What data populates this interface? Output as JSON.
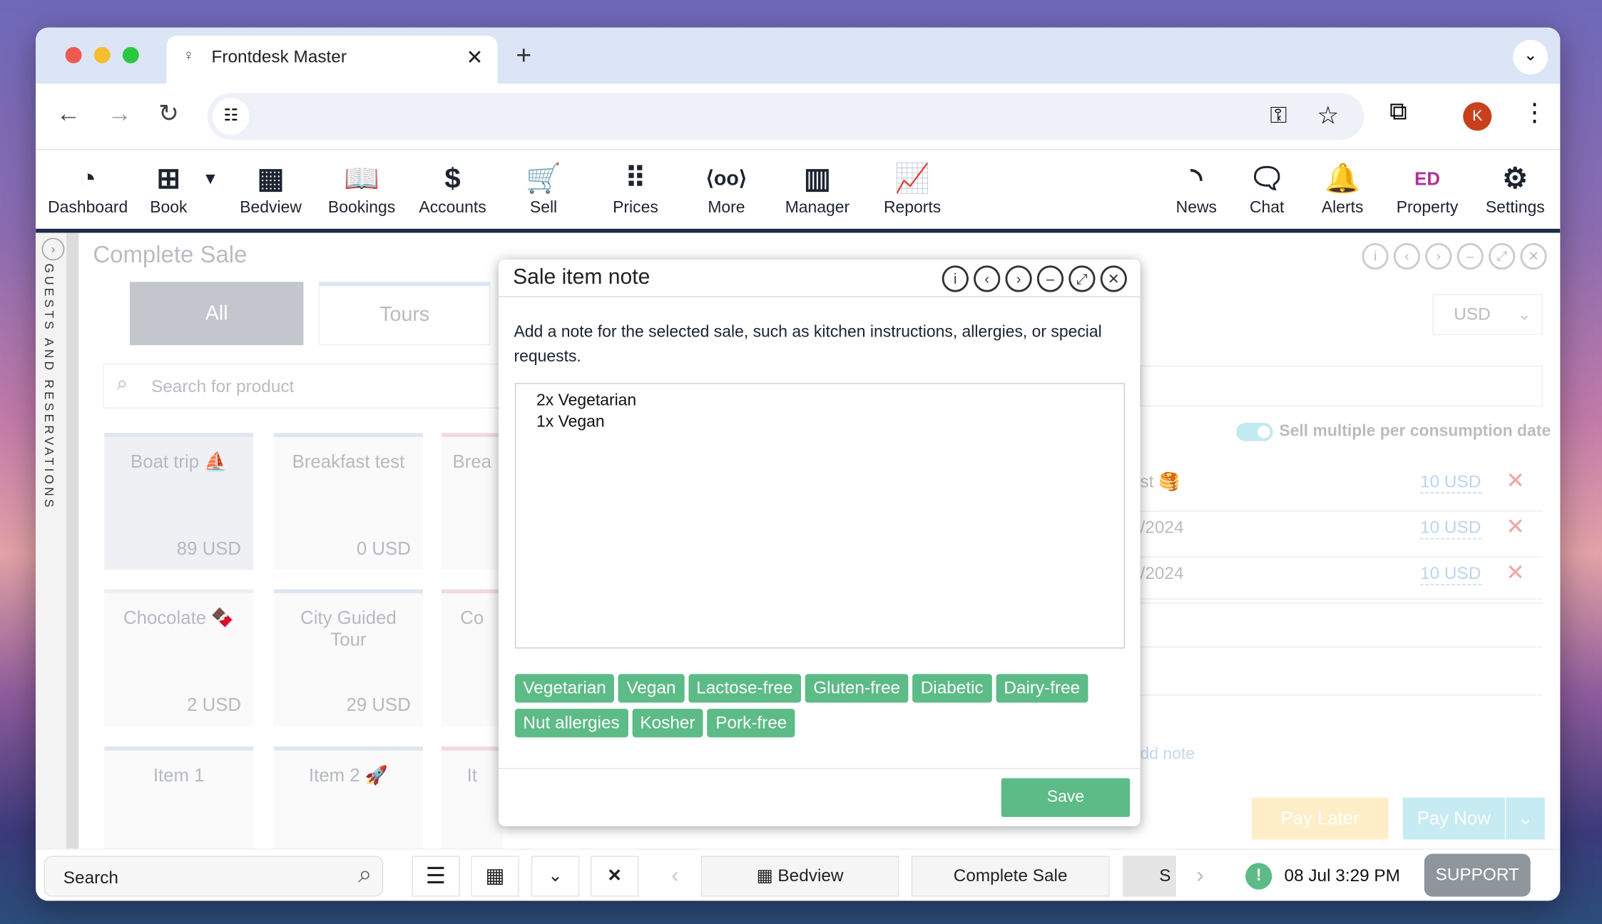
{
  "browser": {
    "tab_title": "Frontdesk Master",
    "new_tab": "+",
    "profile_initial": "K"
  },
  "nav": {
    "items": [
      {
        "label": "Dashboard",
        "icon": "dashboard-gauge-icon",
        "glyph": "◔"
      },
      {
        "label": "Book",
        "icon": "plus-box-icon",
        "glyph": "⊞"
      },
      {
        "label": "Bedview",
        "icon": "grid-icon",
        "glyph": "▦"
      },
      {
        "label": "Bookings",
        "icon": "book-icon",
        "glyph": "📖"
      },
      {
        "label": "Accounts",
        "icon": "money-search-icon",
        "glyph": "$"
      },
      {
        "label": "Sell",
        "icon": "cart-icon",
        "glyph": "🛒"
      },
      {
        "label": "Prices",
        "icon": "dots-grid-icon",
        "glyph": "⠿"
      },
      {
        "label": "More",
        "icon": "more-icon",
        "glyph": "⟨oo⟩"
      },
      {
        "label": "Manager",
        "icon": "building-icon",
        "glyph": "▥"
      },
      {
        "label": "Reports",
        "icon": "chart-icon",
        "glyph": "📈"
      },
      {
        "label": "News",
        "icon": "rss-icon",
        "glyph": "◝"
      },
      {
        "label": "Chat",
        "icon": "chat-icon",
        "glyph": "🗨"
      },
      {
        "label": "Alerts",
        "icon": "bell-icon",
        "glyph": "🔔"
      },
      {
        "label": "Property",
        "icon": "property-icon",
        "glyph": "ED"
      },
      {
        "label": "Settings",
        "icon": "gear-icon",
        "glyph": "⚙"
      }
    ]
  },
  "sidebar": {
    "label": "GUESTS AND RESERVATIONS"
  },
  "page": {
    "title": "Complete Sale",
    "categories": [
      "All",
      "Tours"
    ],
    "search_placeholder": "Search for product",
    "currency": "USD",
    "sell_multiple_label": "Sell multiple per consumption date",
    "sell_multiple_on": true,
    "products": [
      {
        "name": "Boat trip ⛵",
        "price": "89 USD"
      },
      {
        "name": "Breakfast test",
        "price": "0 USD"
      },
      {
        "name": "Brea",
        "price": ""
      },
      {
        "name": "Chocolate 🍫",
        "price": "2 USD"
      },
      {
        "name": "City Guided Tour",
        "price": "29 USD"
      },
      {
        "name": "Co",
        "price": ""
      },
      {
        "name": "Item 1",
        "price": ""
      },
      {
        "name": "Item 2 🚀",
        "price": ""
      },
      {
        "name": "It",
        "price": ""
      }
    ],
    "lines": [
      {
        "label": "st 🥞",
        "price": "10 USD"
      },
      {
        "label": "/2024",
        "price": "10 USD"
      },
      {
        "label": "/2024",
        "price": "10 USD"
      }
    ],
    "add_note": "dd note",
    "pay_later": "Pay Later",
    "pay_now": "Pay Now"
  },
  "modal": {
    "title": "Sale item note",
    "description": "Add a note for the selected sale, such as kitchen instructions, allergies, or special requests.",
    "note_value": "2x Vegetarian\n1x Vegan",
    "tags": [
      "Vegetarian",
      "Vegan",
      "Lactose-free",
      "Gluten-free",
      "Diabetic",
      "Dairy-free",
      "Nut allergies",
      "Kosher",
      "Pork-free"
    ],
    "save": "Save"
  },
  "bottom": {
    "search": "Search",
    "tabs": [
      "Bedview",
      "Complete Sale",
      "S"
    ],
    "datetime": "08 Jul 3:29 PM",
    "support": "SUPPORT"
  },
  "colors": {
    "accent_green": "#5cbb86",
    "nav_bar": "#1c2b4a"
  }
}
